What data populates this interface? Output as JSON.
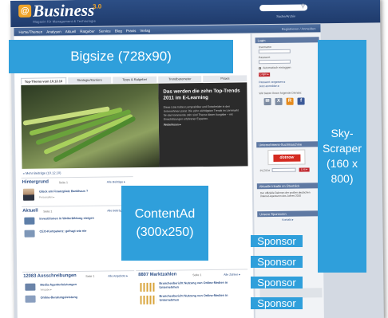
{
  "header": {
    "logo_badge": "@",
    "logo_text": "Business",
    "logo_version": "3.0",
    "tagline": "Magazin für Management & Technologie",
    "search_link": "Suche/Archiv",
    "nav_items": [
      "Home/Themen",
      "Analysen",
      "Aktuell",
      "Ratgeber",
      "Service",
      "Blog",
      "Praxis",
      "Verlag"
    ],
    "nav_right": "Registrieren / Anmelden"
  },
  "ads": {
    "bigsize": "Bigsize (728x90)",
    "skyscraper": "Sky-\nScraper\n(160 x\n800)",
    "content_ad": "ContentAd\n(300x250)",
    "sponsor": "Sponsor"
  },
  "feature": {
    "tabs": [
      "Top-Thema vom 10.12.10",
      "Strategie/Karriere",
      "Tipps & Ratgeber",
      "Trendbarometer",
      "Praxis"
    ],
    "title": "Das werden die zehn Top-Trends 2011 im E-Learning",
    "body": "Diese Liste halten Lernpraktiker und Entscheider in den Unternehmen parat: Die zehn wichtigsten Trends im Lernmarkt für das kommende Jahr sind Thema dieser Ausgabe – mit Einschätzungen erfahrener Experten.",
    "more": "Weiterlesen ▸",
    "footer_link": "» Mehr Beiträge (10.12.10)"
  },
  "sections": {
    "hintergrund": {
      "title": "Hintergrund",
      "meta": "Seite 1",
      "link": "Alle Beiträge ▸"
    },
    "hintergrund_item": {
      "title": "Glück am Finanzplatz Bankhaus ?",
      "sub": "Personalien ▸"
    },
    "aktuell": {
      "title": "Aktuell",
      "meta": "Seite 1",
      "link": "Alle Beiträge ▸"
    },
    "aktuell_items": [
      {
        "title": "Investitionen in Weiterbildung steigen",
        "sub": ""
      },
      {
        "title": "CEO-Kompetenz: gefragt wie nie",
        "sub": ""
      }
    ],
    "ausschreibungen": {
      "title": "12083 Ausschreibungen",
      "meta": "Seite 1",
      "link": "Alle Angebote ▸"
    },
    "ausschreibungen_items": [
      {
        "title": "Media-Agenturleistungen",
        "sub": "Vergabe ▸"
      },
      {
        "title": "Online-Beratungsleistung",
        "sub": ""
      }
    ],
    "marktzahlen": {
      "title": "8807 Marktzahlen",
      "meta": "Seite 1",
      "link": "Alle Zahlen ▸"
    },
    "marktzahlen_items": [
      {
        "title": "Branchenbericht Nutzung von Online-Medien in Unternehmen",
        "sub": ""
      },
      {
        "title": "Branchenbericht Nutzung von Online-Medien in Unternehmen",
        "sub": ""
      }
    ]
  },
  "sidebar": {
    "login_head": "Login",
    "username_label": "Username",
    "password_label": "Passwort",
    "remember_label": "Automatisch einloggen",
    "login_button": "Login ▸",
    "forgot_link": "Passwort vergessen ▸",
    "register_link": "Jetzt anmelden ▸",
    "social_label": "Wir bieten Ihnen folgende Dienste:",
    "social_icons": [
      {
        "name": "email-icon",
        "glyph": "✉",
        "color": "#7f8da3"
      },
      {
        "name": "xing-icon",
        "glyph": "X",
        "color": "#7f8da3"
      },
      {
        "name": "rss-icon",
        "glyph": "R",
        "color": "#e58a1c"
      },
      {
        "name": "facebook-icon",
        "glyph": "f",
        "color": "#3b5998"
      }
    ],
    "partner_head": "Unternehmens-Suchmaschine",
    "partner_logo": "dotnow",
    "plz_label": "PLZ/Ort",
    "go_button": "Los ▸",
    "newsletter_head": "Aktuelle Inhalte im Überblick",
    "newsletter_text": "Der offizielle Rahmen der großen deutschen Internet-Agenturen des Jahres 2010",
    "sponsor_head": "Unsere Sponsoren",
    "sponsor_link": "Kontakt ▸",
    "bottom_link": "Kontakt ▸"
  }
}
